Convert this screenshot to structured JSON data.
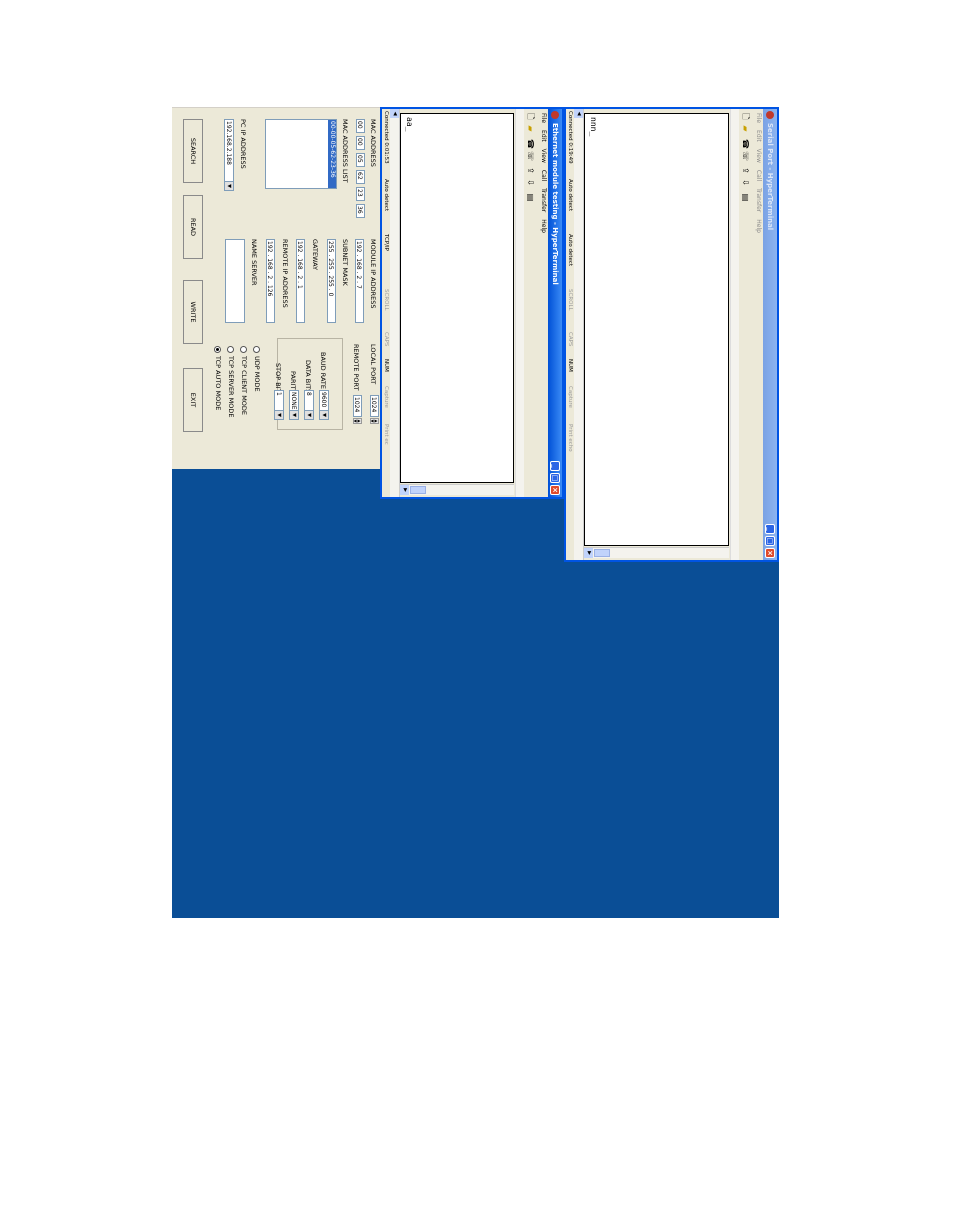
{
  "config": {
    "mac_address_label": "MAC ADDRESS",
    "mac_octets": [
      "00",
      "00",
      "05",
      "62",
      "23",
      "36"
    ],
    "mac_list_label": "MAC ADDRESS LIST",
    "mac_list_items": [
      "00-00-05-62-23-36"
    ],
    "pc_ip_label": "PC IP ADDRESS",
    "pc_ip_value": "192.168.2.188",
    "module_ip_label": "MODULE IP ADDRESS",
    "module_ip": [
      "192",
      "168",
      "2",
      "7"
    ],
    "subnet_label": "SUBNET MASK",
    "subnet": [
      "255",
      "255",
      "255",
      "0"
    ],
    "gateway_label": "GATEWAY",
    "gateway": [
      "192",
      "168",
      "2",
      "1"
    ],
    "remote_ip_label": "REMOTE IP ADDRESS",
    "remote_ip": [
      "192",
      "168",
      "2",
      "126"
    ],
    "name_server_label": "NAME SERVER",
    "local_port_label": "LOCAL PORT",
    "local_port": "1024",
    "remote_port_label": "REMOTE PORT",
    "remote_port": "1024",
    "baud_rate_label": "BAUD RATE",
    "baud_rate": "9600",
    "data_bits_label": "DATA BITS",
    "data_bits": "8",
    "parity_label": "PARITY",
    "parity": "NONE",
    "stop_bits_label": "STOP BITS",
    "stop_bits": "1",
    "modes": [
      {
        "label": "UDP MODE",
        "selected": false
      },
      {
        "label": "TCP CLIENT MODE",
        "selected": false
      },
      {
        "label": "TCP SERVER MODE",
        "selected": false
      },
      {
        "label": "TCP AUTO MODE",
        "selected": true
      }
    ],
    "buttons": {
      "search": "SEARCH",
      "read": "READ",
      "write": "WRITE",
      "exit": "EXIT"
    }
  },
  "eth_window": {
    "title": "Ethernet module testing - HyperTerminal",
    "menu": [
      "File",
      "Edit",
      "View",
      "Call",
      "Transfer",
      "Help"
    ],
    "terminal_text": "aa_",
    "status": {
      "connected": "Connected 0:01:53",
      "detect1": "Auto detect",
      "proto": "TCP/IP",
      "scroll": "SCROLL",
      "caps": "CAPS",
      "num": "NUM",
      "capture": "Capture",
      "print": "Print ec"
    }
  },
  "serial_window": {
    "title": "Serial Port - HyperTerminal",
    "menu": [
      "File",
      "Edit",
      "View",
      "Call",
      "Transfer",
      "Help"
    ],
    "terminal_text": "nnn_",
    "status": {
      "connected": "Connected 0:19:49",
      "detect1": "Auto detect",
      "detect2": "Auto detect",
      "scroll": "SCROLL",
      "caps": "CAPS",
      "num": "NUM",
      "capture": "Capture",
      "print": "Print echo"
    }
  }
}
